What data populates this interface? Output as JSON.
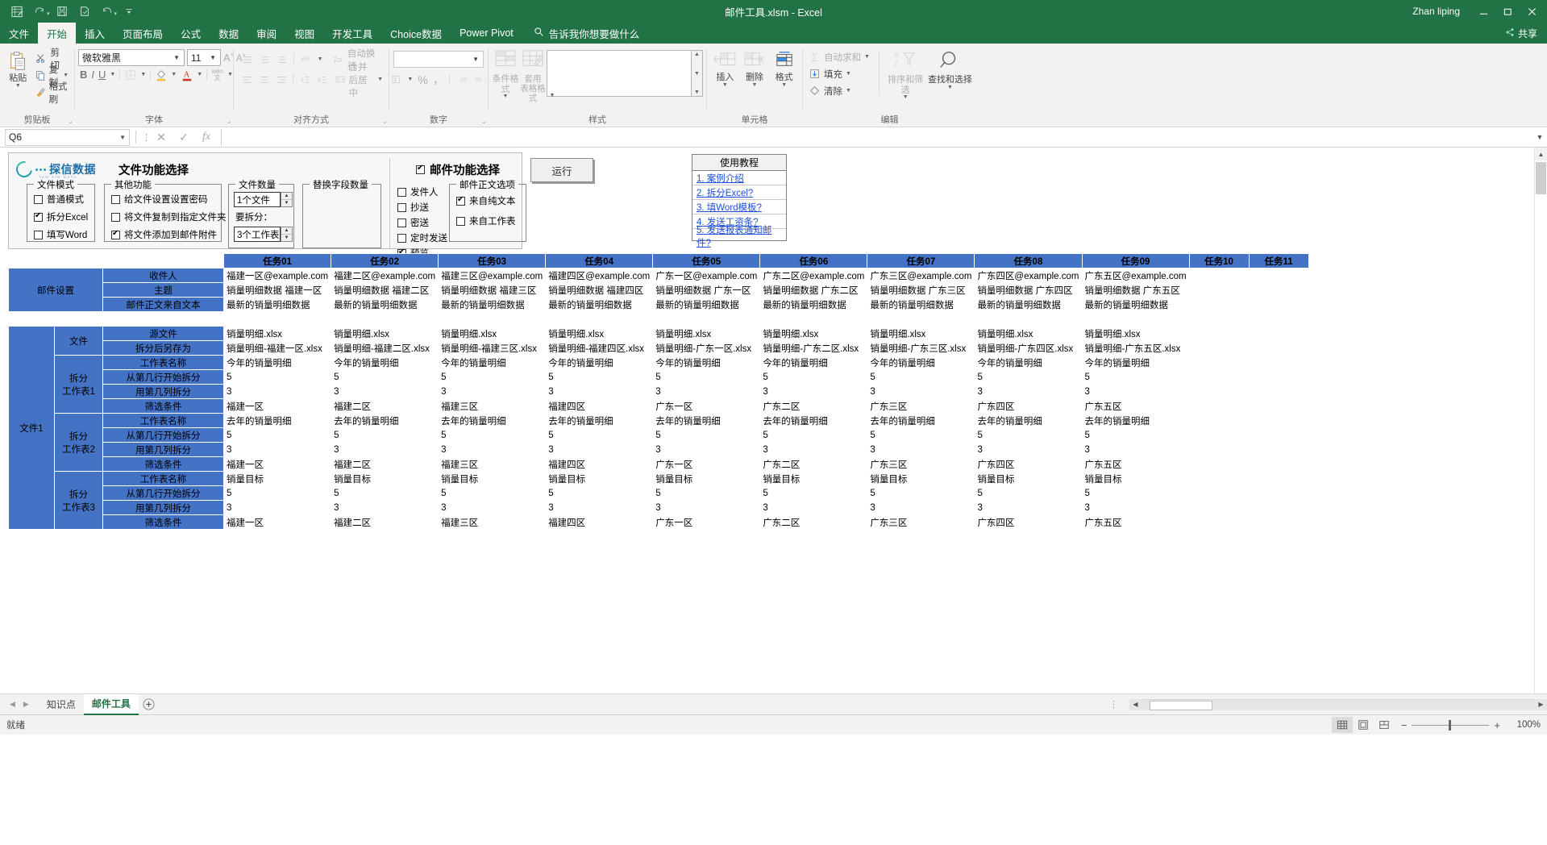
{
  "titlebar": {
    "document_title": "邮件工具.xlsm  -  Excel",
    "user": "Zhan liping",
    "qat": [
      "excel-icon",
      "redo-icon",
      "save-icon",
      "save-as-icon",
      "undo-icon",
      "customize-icon"
    ],
    "window_buttons": [
      "minimize",
      "restore",
      "close"
    ]
  },
  "ribbon_tabs": [
    {
      "label": "文件"
    },
    {
      "label": "开始"
    },
    {
      "label": "插入"
    },
    {
      "label": "页面布局"
    },
    {
      "label": "公式"
    },
    {
      "label": "数据"
    },
    {
      "label": "审阅"
    },
    {
      "label": "视图"
    },
    {
      "label": "开发工具"
    },
    {
      "label": "Choice数据"
    },
    {
      "label": "Power Pivot"
    }
  ],
  "tell_me": "告诉我你想要做什么",
  "share_label": "共享",
  "ribbon": {
    "clipboard": {
      "group_label": "剪贴板",
      "paste": "粘贴",
      "cut": "剪切",
      "copy": "复制",
      "format_painter": "格式刷"
    },
    "font": {
      "group_label": "字体",
      "font_name": "微软雅黑",
      "font_size": "11",
      "grow": "A",
      "shrink": "A",
      "bold": "B",
      "italic": "I",
      "underline": "U"
    },
    "alignment": {
      "group_label": "对齐方式",
      "wrap_text": "自动换行",
      "merge_center": "合并后居中"
    },
    "number": {
      "group_label": "数字",
      "format_value": "",
      "percent": "%",
      "comma": "，"
    },
    "styles": {
      "group_label": "样式",
      "conditional": "条件格式",
      "table_format": "套用\n表格格式"
    },
    "cells": {
      "group_label": "单元格",
      "insert": "插入",
      "delete": "删除",
      "format": "格式"
    },
    "editing": {
      "group_label": "编辑",
      "autosum": "自动求和",
      "fill": "填充",
      "clear": "清除",
      "sort_filter": "排序和筛选",
      "find_select": "查找和选择"
    }
  },
  "formula_bar": {
    "name_box": "Q6",
    "cancel": "✕",
    "confirm": "✓",
    "fx": "fx",
    "formula_value": ""
  },
  "form_panel": {
    "logo_text": "探信数据",
    "logo_sub": "TAN XIN DATA",
    "file_function_title": "文件功能选择",
    "mail_function_title": "邮件功能选择",
    "mail_function_checked": true,
    "file_mode": {
      "label": "文件模式",
      "items": [
        {
          "label": "普通模式",
          "checked": false
        },
        {
          "label": "拆分Excel",
          "checked": true
        },
        {
          "label": "填写Word",
          "checked": false
        }
      ]
    },
    "other_functions": {
      "label": "其他功能",
      "items": [
        {
          "label": "给文件设置设置密码",
          "checked": false
        },
        {
          "label": "将文件复制到指定文件夹",
          "checked": false
        },
        {
          "label": "将文件添加到邮件附件",
          "checked": true
        }
      ]
    },
    "file_count": {
      "label": "文件数量",
      "count_value": "1个文件",
      "split_label": "要拆分：",
      "split_value": "3个工作表"
    },
    "replace_fields": {
      "label": "替换字段数量"
    },
    "mail_options": [
      {
        "label": "发件人",
        "checked": false
      },
      {
        "label": "抄送",
        "checked": false
      },
      {
        "label": "密送",
        "checked": false
      },
      {
        "label": "定时发送",
        "checked": false
      },
      {
        "label": "预览",
        "checked": true
      }
    ],
    "mail_body_options": {
      "label": "邮件正文选项",
      "items": [
        {
          "label": "来自纯文本",
          "checked": true
        },
        {
          "label": "来自工作表",
          "checked": false
        }
      ]
    },
    "run_button": "运行",
    "tutorial": {
      "title": "使用教程",
      "links": [
        "1. 案例介绍",
        "2. 拆分Excel?",
        "3. 填Word模板?",
        "4. 发送工资条?",
        "5. 发送报表通知邮件?"
      ]
    }
  },
  "table": {
    "task_headers": [
      "任务01",
      "任务02",
      "任务03",
      "任务04",
      "任务05",
      "任务06",
      "任务07",
      "任务08",
      "任务09",
      "任务10",
      "任务11"
    ],
    "mail_settings": {
      "group": "邮件设置",
      "rows": [
        {
          "label": "收件人",
          "values": [
            "福建一区@example.com",
            "福建二区@example.com",
            "福建三区@example.com",
            "福建四区@example.com",
            "广东一区@example.com",
            "广东二区@example.com",
            "广东三区@example.com",
            "广东四区@example.com",
            "广东五区@example.com",
            "",
            ""
          ]
        },
        {
          "label": "主题",
          "values": [
            "销量明细数据 福建一区",
            "销量明细数据 福建二区",
            "销量明细数据 福建三区",
            "销量明细数据 福建四区",
            "销量明细数据 广东一区",
            "销量明细数据 广东二区",
            "销量明细数据 广东三区",
            "销量明细数据 广东四区",
            "销量明细数据 广东五区",
            "",
            ""
          ]
        },
        {
          "label": "邮件正文来自文本",
          "values": [
            "最新的销量明细数据",
            "最新的销量明细数据",
            "最新的销量明细数据",
            "最新的销量明细数据",
            "最新的销量明细数据",
            "最新的销量明细数据",
            "最新的销量明细数据",
            "最新的销量明细数据",
            "最新的销量明细数据",
            "",
            ""
          ]
        }
      ]
    },
    "file1": {
      "group": "文件1",
      "sections": [
        {
          "name": "文件",
          "rows": [
            {
              "label": "源文件",
              "values": [
                "销量明细.xlsx",
                "销量明细.xlsx",
                "销量明细.xlsx",
                "销量明细.xlsx",
                "销量明细.xlsx",
                "销量明细.xlsx",
                "销量明细.xlsx",
                "销量明细.xlsx",
                "销量明细.xlsx",
                "",
                ""
              ]
            },
            {
              "label": "拆分后另存为",
              "values": [
                "销量明细-福建一区.xlsx",
                "销量明细-福建二区.xlsx",
                "销量明细-福建三区.xlsx",
                "销量明细-福建四区.xlsx",
                "销量明细-广东一区.xlsx",
                "销量明细-广东二区.xlsx",
                "销量明细-广东三区.xlsx",
                "销量明细-广东四区.xlsx",
                "销量明细-广东五区.xlsx",
                "",
                ""
              ]
            }
          ]
        },
        {
          "name": "拆分\n工作表1",
          "rows": [
            {
              "label": "工作表名称",
              "values": [
                "今年的销量明细",
                "今年的销量明细",
                "今年的销量明细",
                "今年的销量明细",
                "今年的销量明细",
                "今年的销量明细",
                "今年的销量明细",
                "今年的销量明细",
                "今年的销量明细",
                "",
                ""
              ]
            },
            {
              "label": "从第几行开始拆分",
              "values": [
                "5",
                "5",
                "5",
                "5",
                "5",
                "5",
                "5",
                "5",
                "5",
                "",
                ""
              ]
            },
            {
              "label": "用第几列拆分",
              "values": [
                "3",
                "3",
                "3",
                "3",
                "3",
                "3",
                "3",
                "3",
                "3",
                "",
                ""
              ]
            },
            {
              "label": "筛选条件",
              "values": [
                "福建一区",
                "福建二区",
                "福建三区",
                "福建四区",
                "广东一区",
                "广东二区",
                "广东三区",
                "广东四区",
                "广东五区",
                "",
                ""
              ]
            }
          ]
        },
        {
          "name": "拆分\n工作表2",
          "rows": [
            {
              "label": "工作表名称",
              "values": [
                "去年的销量明细",
                "去年的销量明细",
                "去年的销量明细",
                "去年的销量明细",
                "去年的销量明细",
                "去年的销量明细",
                "去年的销量明细",
                "去年的销量明细",
                "去年的销量明细",
                "",
                ""
              ]
            },
            {
              "label": "从第几行开始拆分",
              "values": [
                "5",
                "5",
                "5",
                "5",
                "5",
                "5",
                "5",
                "5",
                "5",
                "",
                ""
              ]
            },
            {
              "label": "用第几列拆分",
              "values": [
                "3",
                "3",
                "3",
                "3",
                "3",
                "3",
                "3",
                "3",
                "3",
                "",
                ""
              ]
            },
            {
              "label": "筛选条件",
              "values": [
                "福建一区",
                "福建二区",
                "福建三区",
                "福建四区",
                "广东一区",
                "广东二区",
                "广东三区",
                "广东四区",
                "广东五区",
                "",
                ""
              ]
            }
          ]
        },
        {
          "name": "拆分\n工作表3",
          "rows": [
            {
              "label": "工作表名称",
              "values": [
                "销量目标",
                "销量目标",
                "销量目标",
                "销量目标",
                "销量目标",
                "销量目标",
                "销量目标",
                "销量目标",
                "销量目标",
                "",
                ""
              ]
            },
            {
              "label": "从第几行开始拆分",
              "values": [
                "5",
                "5",
                "5",
                "5",
                "5",
                "5",
                "5",
                "5",
                "5",
                "",
                ""
              ]
            },
            {
              "label": "用第几列拆分",
              "values": [
                "3",
                "3",
                "3",
                "3",
                "3",
                "3",
                "3",
                "3",
                "3",
                "",
                ""
              ]
            },
            {
              "label": "筛选条件",
              "values": [
                "福建一区",
                "福建二区",
                "福建三区",
                "福建四区",
                "广东一区",
                "广东二区",
                "广东三区",
                "广东四区",
                "广东五区",
                "",
                ""
              ]
            }
          ]
        }
      ]
    }
  },
  "sheet_tabs": {
    "items": [
      {
        "label": "知识点",
        "active": false
      },
      {
        "label": "邮件工具",
        "active": true
      }
    ],
    "add_label": "+"
  },
  "status_bar": {
    "status": "就绪",
    "zoom": "100%",
    "views": [
      "normal-view",
      "page-layout-view",
      "page-break-view"
    ]
  },
  "colors": {
    "excel_green": "#217346",
    "header_blue": "#4472c4",
    "link_blue": "#1f4fd8"
  }
}
